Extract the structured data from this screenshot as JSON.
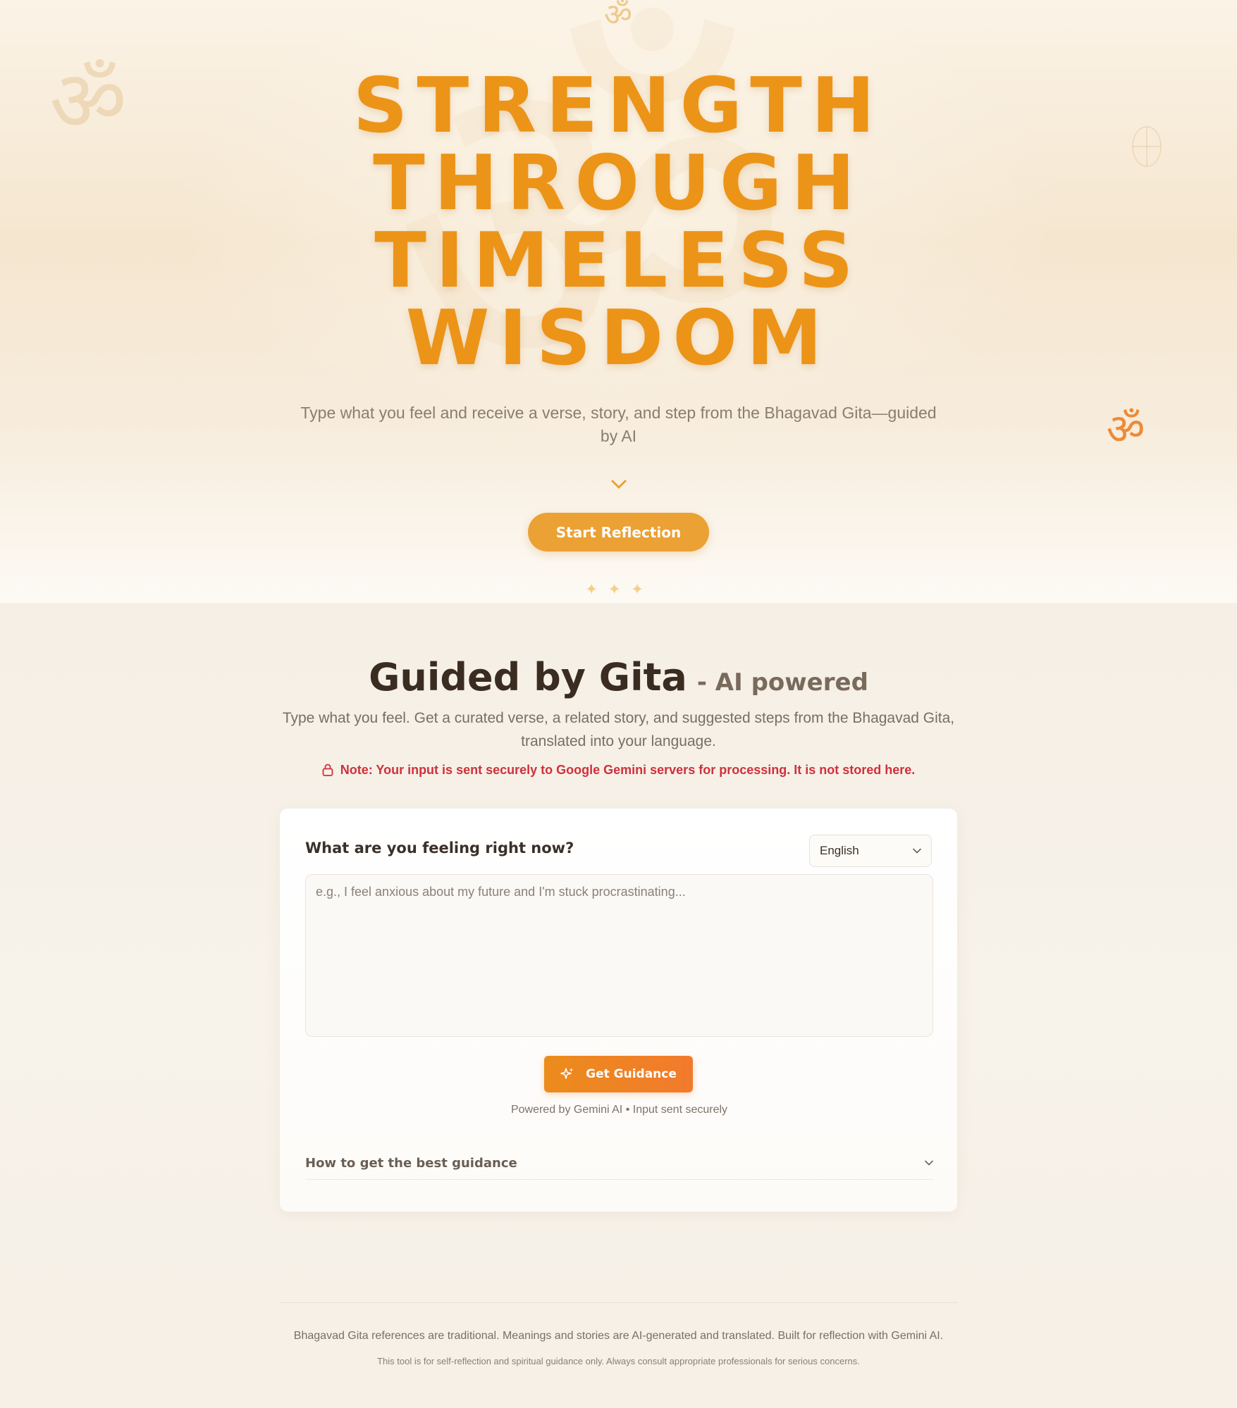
{
  "hero": {
    "title_lines": [
      "STRENGTH",
      "THROUGH",
      "TIMELESS",
      "WISDOM"
    ],
    "subtitle": "Type what you feel and receive a verse, story, and step from the Bhagavad Gita—guided by AI",
    "cta_label": "Start Reflection",
    "decor": {
      "om_symbol": "ॐ",
      "om_icon": "om-icon",
      "lotus_icon": "lotus-icon",
      "chevron_icon": "chevron-down-icon",
      "sparkles": "✦✦✦"
    },
    "colors": {
      "title": "#ec9418",
      "cta": "#eba133"
    }
  },
  "guidance": {
    "title": "Guided by Gita",
    "title_tag": "- AI powered",
    "description": "Type what you feel. Get a curated verse, a related story, and suggested steps from the Bhagavad Gita, translated into your language.",
    "note": "Note: Your input is sent securely to Google Gemini servers for processing. It is not stored here.",
    "note_color": "#d0303a"
  },
  "form": {
    "label": "What are you feeling right now?",
    "language": {
      "selected": "English"
    },
    "input": {
      "placeholder": "e.g., I feel anxious about my future and I'm stuck procrastinating...",
      "value": ""
    },
    "submit_label": "Get Guidance",
    "powered_by": "Powered by Gemini AI • Input sent securely",
    "accordion_label": "How to get the best guidance"
  },
  "footer": {
    "line1": "Bhagavad Gita references are traditional. Meanings and stories are AI-generated and translated. Built for reflection with Gemini AI.",
    "line2": "This tool is for self-reflection and spiritual guidance only. Always consult appropriate professionals for serious concerns."
  }
}
